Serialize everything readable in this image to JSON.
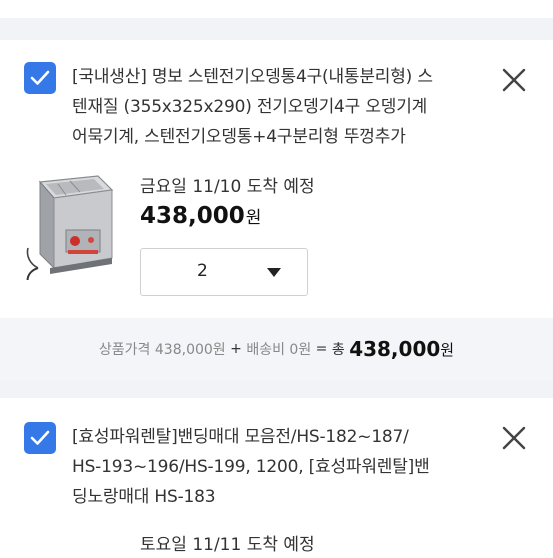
{
  "items": [
    {
      "checked": true,
      "title_lines": [
        "[국내생산] 명보 스텐전기오뎅통4구(내통분리형) 스",
        "텐재질 (355x325x290) 전기오뎅기4구 오뎅기계",
        "어묵기계, 스텐전기오뎅통+4구분리형 뚜껑추가"
      ],
      "eta": "금요일 11/10 도착 예정",
      "price": "438,000",
      "price_unit": "원",
      "quantity": "2"
    },
    {
      "checked": true,
      "title_lines": [
        "[효성파워렌탈]밴딩매대 모음전/HS-182~187/",
        "HS-193~196/HS-199, 1200, [효성파워렌탈]밴",
        "딩노랑매대 HS-183"
      ],
      "eta": "토요일 11/11 도착 예정"
    }
  ],
  "summary": {
    "product_price_label": "상품가격",
    "product_price": "438,000원",
    "plus": "+",
    "shipping_label": "배송비",
    "shipping_fee": "0원",
    "equals": "=",
    "total_label": "총",
    "total_amount": "438,000",
    "total_unit": "원"
  },
  "icons": {
    "checkbox": "check-icon",
    "remove": "close-icon",
    "quantity": "chevron-down-icon"
  },
  "colors": {
    "accent": "#3579e8",
    "background": "#f2f3f6"
  }
}
